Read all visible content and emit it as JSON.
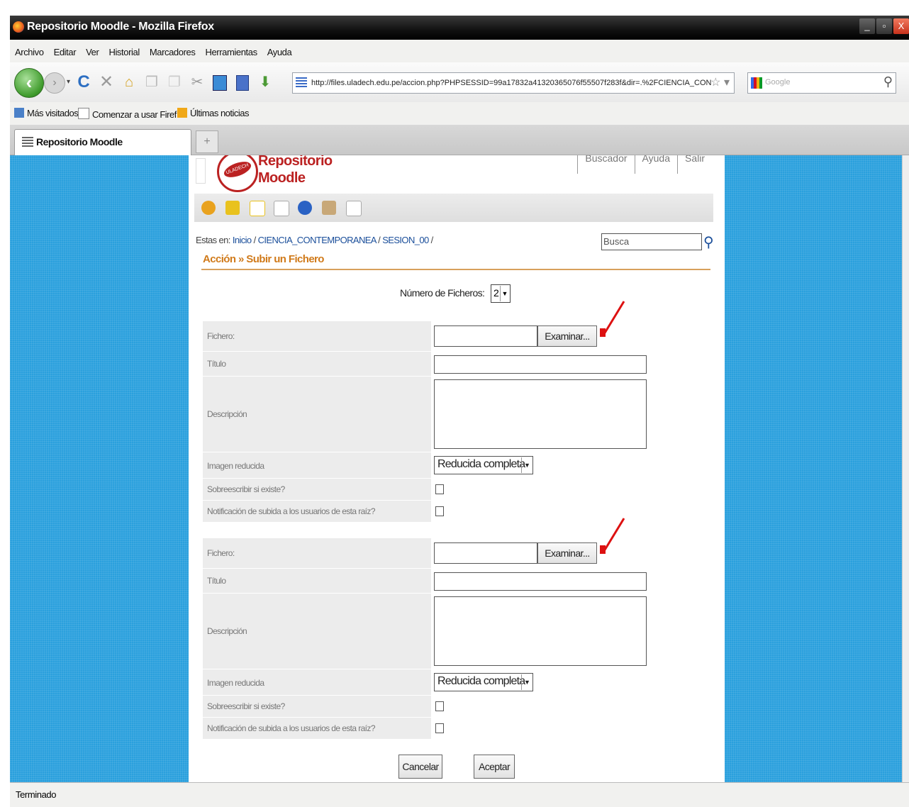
{
  "window": {
    "title": "Repositorio Moodle - Mozilla Firefox",
    "minimize": "_",
    "maximize": "▫",
    "close": "X"
  },
  "menu": [
    "Archivo",
    "Editar",
    "Ver",
    "Historial",
    "Marcadores",
    "Herramientas",
    "Ayuda"
  ],
  "nav": {
    "url": "http://files.uladech.edu.pe/accion.php?PHPSESSID=99a17832a41320365076f55507f283f&dir=.%2FCIENCIA_CON",
    "search_placeholder": "Google"
  },
  "bookmarks": [
    "Más visitados",
    "Comenzar a usar Firef...",
    "Últimas noticias"
  ],
  "tab": {
    "label": "Repositorio Moodle",
    "new_tab": "+"
  },
  "site": {
    "brand_line1": "Repositorio",
    "brand_line2": "Moodle",
    "logo_text": "ULADECH",
    "links": [
      "Buscador",
      "Ayuda",
      "Salir"
    ],
    "breadcrumb_prefix": "Estas en:",
    "breadcrumb": [
      "Inicio",
      "CIENCIA_CONTEMPORANEA",
      "SESION_00"
    ],
    "breadcrumb_sep": " / ",
    "search_placeholder": "Busca",
    "action_title": "Acción » Subir un Fichero"
  },
  "form": {
    "num_label": "Número de Ficheros:",
    "num_value": "2",
    "files": [
      {
        "fichero_label": "Fichero:",
        "browse_label": "Examinar...",
        "titulo_label": "Título",
        "descripcion_label": "Descripción",
        "imagen_label": "Imagen reducida",
        "imagen_value": "Reducida completa",
        "sobreescribir_label": "Sobreescribir si existe?",
        "sobreescribir_checked": false,
        "notificacion_label": "Notificación de subida a los usuarios de esta raíz?",
        "notificacion_checked": false
      },
      {
        "fichero_label": "Fichero:",
        "browse_label": "Examinar...",
        "titulo_label": "Título",
        "descripcion_label": "Descripción",
        "imagen_label": "Imagen reducida",
        "imagen_value": "Reducida completa",
        "sobreescribir_label": "Sobreescribir si existe?",
        "sobreescribir_checked": false,
        "notificacion_label": "Notificación de subida a los usuarios de esta raíz?",
        "notificacion_checked": false
      }
    ],
    "cancel_label": "Cancelar",
    "accept_label": "Aceptar"
  },
  "status": "Terminado",
  "colors": {
    "background": "#2aa0dd",
    "brand": "#bb2222",
    "accent": "#d07a1a",
    "annotation": "#dd1111"
  }
}
